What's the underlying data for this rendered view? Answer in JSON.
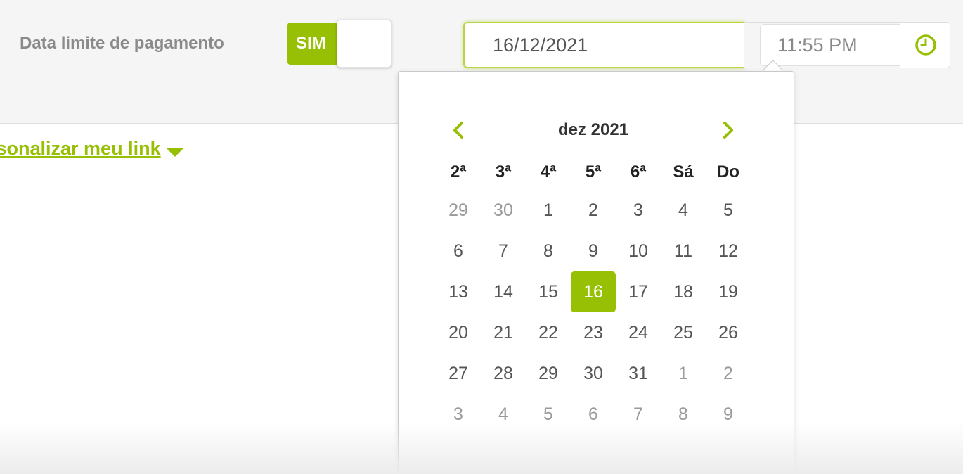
{
  "colors": {
    "accent": "#97c005",
    "label_gray": "#8a8a8a",
    "top_band": "#f5f5f5"
  },
  "deadline": {
    "label": "Data limite de pagamento",
    "toggle_label": "SIM",
    "date_value": "16/12/2021",
    "time_value": "11:55 PM",
    "time_icon": "clock-icon"
  },
  "personalize": {
    "link_text": "rsonalizar meu link",
    "icon": "caret-down-icon"
  },
  "calendar": {
    "month_title": "dez 2021",
    "prev_icon": "chevron-left-icon",
    "next_icon": "chevron-right-icon",
    "weekdays": [
      "2ª",
      "3ª",
      "4ª",
      "5ª",
      "6ª",
      "Sá",
      "Do"
    ],
    "weeks": [
      [
        {
          "d": "29",
          "other": true
        },
        {
          "d": "30",
          "other": true
        },
        {
          "d": "1"
        },
        {
          "d": "2"
        },
        {
          "d": "3"
        },
        {
          "d": "4"
        },
        {
          "d": "5"
        }
      ],
      [
        {
          "d": "6"
        },
        {
          "d": "7"
        },
        {
          "d": "8"
        },
        {
          "d": "9"
        },
        {
          "d": "10"
        },
        {
          "d": "11"
        },
        {
          "d": "12"
        }
      ],
      [
        {
          "d": "13"
        },
        {
          "d": "14"
        },
        {
          "d": "15"
        },
        {
          "d": "16",
          "selected": true
        },
        {
          "d": "17"
        },
        {
          "d": "18"
        },
        {
          "d": "19"
        }
      ],
      [
        {
          "d": "20"
        },
        {
          "d": "21"
        },
        {
          "d": "22"
        },
        {
          "d": "23"
        },
        {
          "d": "24"
        },
        {
          "d": "25"
        },
        {
          "d": "26"
        }
      ],
      [
        {
          "d": "27"
        },
        {
          "d": "28"
        },
        {
          "d": "29"
        },
        {
          "d": "30"
        },
        {
          "d": "31"
        },
        {
          "d": "1",
          "other": true
        },
        {
          "d": "2",
          "other": true
        }
      ],
      [
        {
          "d": "3",
          "other": true
        },
        {
          "d": "4",
          "other": true
        },
        {
          "d": "5",
          "other": true
        },
        {
          "d": "6",
          "other": true
        },
        {
          "d": "7",
          "other": true
        },
        {
          "d": "8",
          "other": true
        },
        {
          "d": "9",
          "other": true
        }
      ]
    ]
  }
}
